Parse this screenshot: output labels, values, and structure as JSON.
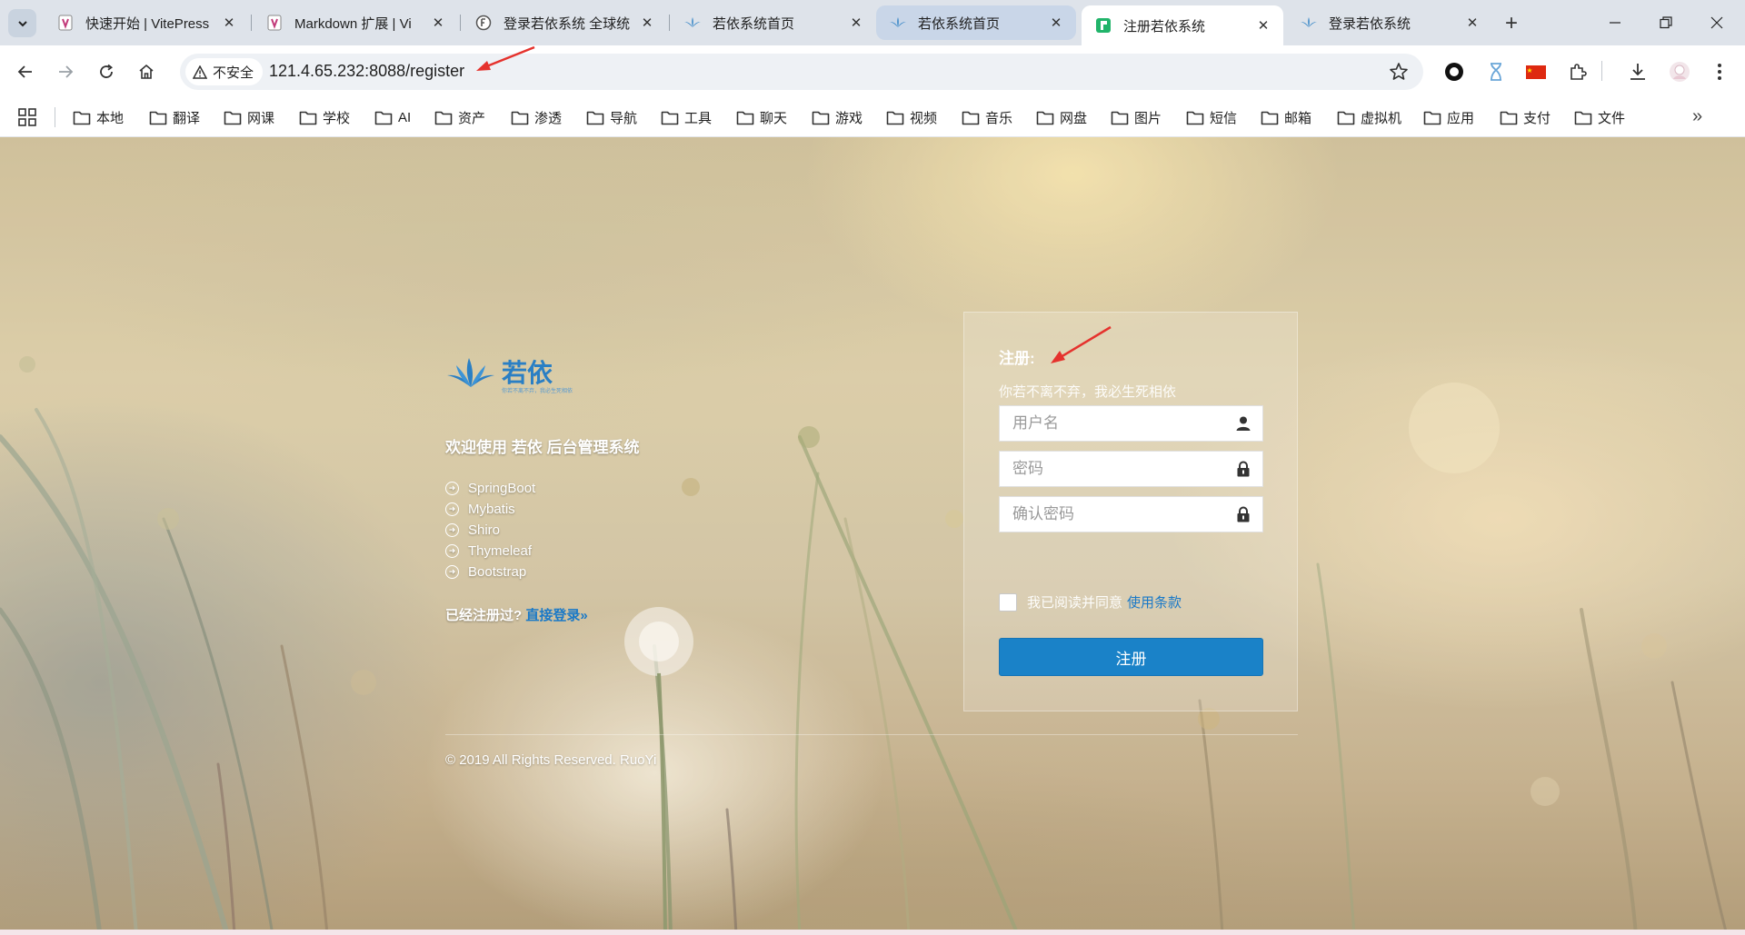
{
  "browser": {
    "tabs": [
      {
        "title": "快速开始 | VitePress",
        "favicon": "vitepress-icon"
      },
      {
        "title": "Markdown 扩展 | Vi",
        "favicon": "vitepress-icon"
      },
      {
        "title": "登录若依系统 全球统",
        "favicon": "fofa-icon"
      },
      {
        "title": "若依系统首页",
        "favicon": "ruoyi-icon"
      },
      {
        "title": "若依系统首页",
        "favicon": "ruoyi-icon",
        "state": "hover"
      },
      {
        "title": "注册若依系统",
        "favicon": "ruoyi-green-icon",
        "state": "active"
      },
      {
        "title": "登录若依系统",
        "favicon": "ruoyi-icon"
      }
    ],
    "security_label": "不安全",
    "url": "121.4.65.232:8088/register",
    "bookmarks": [
      "本地",
      "翻译",
      "网课",
      "学校",
      "AI",
      "资产",
      "渗透",
      "导航",
      "工具",
      "聊天",
      "游戏",
      "视频",
      "音乐",
      "网盘",
      "图片",
      "短信",
      "邮箱",
      "虚拟机",
      "应用",
      "支付",
      "文件"
    ]
  },
  "colors": {
    "accent": "#1a82c8",
    "link": "#1a79c7",
    "annotation_arrow": "#e5322d"
  },
  "intro": {
    "logo_text": "若依",
    "logo_slogan": "你若不离不弃，我必生死相依",
    "welcome": "欢迎使用 若依 后台管理系统",
    "techs": [
      "SpringBoot",
      "Mybatis",
      "Shiro",
      "Thymeleaf",
      "Bootstrap"
    ],
    "already_registered": "已经注册过?",
    "login_link": "直接登录»"
  },
  "register": {
    "title": "注册:",
    "subtitle": "你若不离不弃，我必生死相依",
    "username_placeholder": "用户名",
    "password_placeholder": "密码",
    "confirm_placeholder": "确认密码",
    "agree_text": "我已阅读并同意",
    "terms_link": "使用条款",
    "submit_label": "注册"
  },
  "footer": {
    "copyright": "© 2019 All Rights Reserved. RuoYi"
  }
}
